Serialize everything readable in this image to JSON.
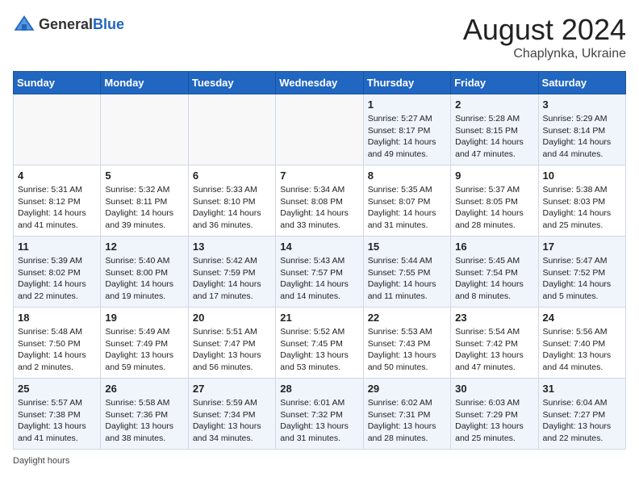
{
  "header": {
    "logo_general": "General",
    "logo_blue": "Blue",
    "month_year": "August 2024",
    "location": "Chaplynka, Ukraine"
  },
  "days_of_week": [
    "Sunday",
    "Monday",
    "Tuesday",
    "Wednesday",
    "Thursday",
    "Friday",
    "Saturday"
  ],
  "weeks": [
    [
      {
        "day": "",
        "info": ""
      },
      {
        "day": "",
        "info": ""
      },
      {
        "day": "",
        "info": ""
      },
      {
        "day": "",
        "info": ""
      },
      {
        "day": "1",
        "info": "Sunrise: 5:27 AM\nSunset: 8:17 PM\nDaylight: 14 hours\nand 49 minutes."
      },
      {
        "day": "2",
        "info": "Sunrise: 5:28 AM\nSunset: 8:15 PM\nDaylight: 14 hours\nand 47 minutes."
      },
      {
        "day": "3",
        "info": "Sunrise: 5:29 AM\nSunset: 8:14 PM\nDaylight: 14 hours\nand 44 minutes."
      }
    ],
    [
      {
        "day": "4",
        "info": "Sunrise: 5:31 AM\nSunset: 8:12 PM\nDaylight: 14 hours\nand 41 minutes."
      },
      {
        "day": "5",
        "info": "Sunrise: 5:32 AM\nSunset: 8:11 PM\nDaylight: 14 hours\nand 39 minutes."
      },
      {
        "day": "6",
        "info": "Sunrise: 5:33 AM\nSunset: 8:10 PM\nDaylight: 14 hours\nand 36 minutes."
      },
      {
        "day": "7",
        "info": "Sunrise: 5:34 AM\nSunset: 8:08 PM\nDaylight: 14 hours\nand 33 minutes."
      },
      {
        "day": "8",
        "info": "Sunrise: 5:35 AM\nSunset: 8:07 PM\nDaylight: 14 hours\nand 31 minutes."
      },
      {
        "day": "9",
        "info": "Sunrise: 5:37 AM\nSunset: 8:05 PM\nDaylight: 14 hours\nand 28 minutes."
      },
      {
        "day": "10",
        "info": "Sunrise: 5:38 AM\nSunset: 8:03 PM\nDaylight: 14 hours\nand 25 minutes."
      }
    ],
    [
      {
        "day": "11",
        "info": "Sunrise: 5:39 AM\nSunset: 8:02 PM\nDaylight: 14 hours\nand 22 minutes."
      },
      {
        "day": "12",
        "info": "Sunrise: 5:40 AM\nSunset: 8:00 PM\nDaylight: 14 hours\nand 19 minutes."
      },
      {
        "day": "13",
        "info": "Sunrise: 5:42 AM\nSunset: 7:59 PM\nDaylight: 14 hours\nand 17 minutes."
      },
      {
        "day": "14",
        "info": "Sunrise: 5:43 AM\nSunset: 7:57 PM\nDaylight: 14 hours\nand 14 minutes."
      },
      {
        "day": "15",
        "info": "Sunrise: 5:44 AM\nSunset: 7:55 PM\nDaylight: 14 hours\nand 11 minutes."
      },
      {
        "day": "16",
        "info": "Sunrise: 5:45 AM\nSunset: 7:54 PM\nDaylight: 14 hours\nand 8 minutes."
      },
      {
        "day": "17",
        "info": "Sunrise: 5:47 AM\nSunset: 7:52 PM\nDaylight: 14 hours\nand 5 minutes."
      }
    ],
    [
      {
        "day": "18",
        "info": "Sunrise: 5:48 AM\nSunset: 7:50 PM\nDaylight: 14 hours\nand 2 minutes."
      },
      {
        "day": "19",
        "info": "Sunrise: 5:49 AM\nSunset: 7:49 PM\nDaylight: 13 hours\nand 59 minutes."
      },
      {
        "day": "20",
        "info": "Sunrise: 5:51 AM\nSunset: 7:47 PM\nDaylight: 13 hours\nand 56 minutes."
      },
      {
        "day": "21",
        "info": "Sunrise: 5:52 AM\nSunset: 7:45 PM\nDaylight: 13 hours\nand 53 minutes."
      },
      {
        "day": "22",
        "info": "Sunrise: 5:53 AM\nSunset: 7:43 PM\nDaylight: 13 hours\nand 50 minutes."
      },
      {
        "day": "23",
        "info": "Sunrise: 5:54 AM\nSunset: 7:42 PM\nDaylight: 13 hours\nand 47 minutes."
      },
      {
        "day": "24",
        "info": "Sunrise: 5:56 AM\nSunset: 7:40 PM\nDaylight: 13 hours\nand 44 minutes."
      }
    ],
    [
      {
        "day": "25",
        "info": "Sunrise: 5:57 AM\nSunset: 7:38 PM\nDaylight: 13 hours\nand 41 minutes."
      },
      {
        "day": "26",
        "info": "Sunrise: 5:58 AM\nSunset: 7:36 PM\nDaylight: 13 hours\nand 38 minutes."
      },
      {
        "day": "27",
        "info": "Sunrise: 5:59 AM\nSunset: 7:34 PM\nDaylight: 13 hours\nand 34 minutes."
      },
      {
        "day": "28",
        "info": "Sunrise: 6:01 AM\nSunset: 7:32 PM\nDaylight: 13 hours\nand 31 minutes."
      },
      {
        "day": "29",
        "info": "Sunrise: 6:02 AM\nSunset: 7:31 PM\nDaylight: 13 hours\nand 28 minutes."
      },
      {
        "day": "30",
        "info": "Sunrise: 6:03 AM\nSunset: 7:29 PM\nDaylight: 13 hours\nand 25 minutes."
      },
      {
        "day": "31",
        "info": "Sunrise: 6:04 AM\nSunset: 7:27 PM\nDaylight: 13 hours\nand 22 minutes."
      }
    ]
  ],
  "footer": {
    "note": "Daylight hours"
  }
}
